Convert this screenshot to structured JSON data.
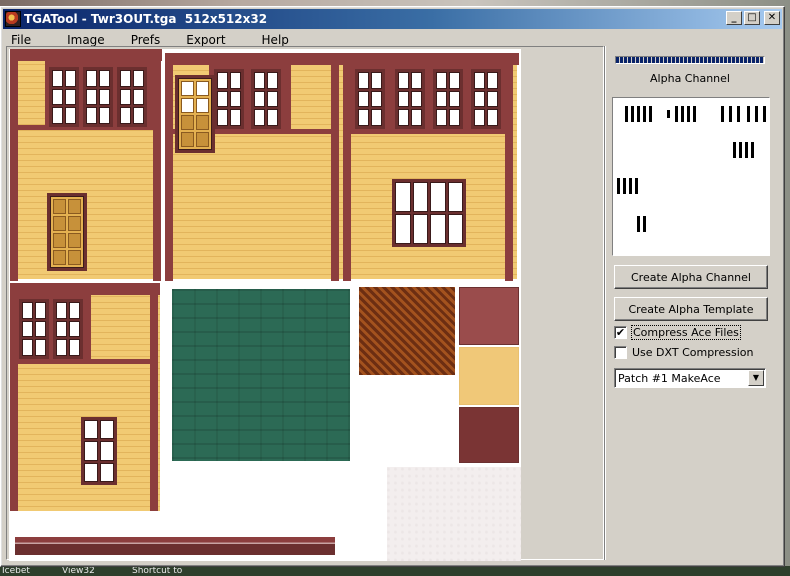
{
  "window": {
    "title": "TGATool - Twr3OUT.tga  512x512x32",
    "minimize": "_",
    "maximize": "□",
    "close": "✕"
  },
  "menu": {
    "items": [
      "File",
      "Image",
      "Prefs",
      "Export",
      "Help"
    ]
  },
  "side": {
    "alpha_label": "Alpha Channel",
    "create_alpha_channel": "Create Alpha Channel",
    "create_alpha_template": "Create Alpha Template",
    "compress_ace": {
      "label": "Compress Ace Files",
      "checked": true
    },
    "use_dxt": {
      "label": "Use DXT Compression",
      "checked": false
    },
    "dropdown": {
      "value": "Patch #1 MakeAce"
    }
  },
  "desktop": {
    "labels": [
      "Icebet",
      "View32",
      "Shortcut to"
    ]
  },
  "colors": {
    "titlebar": "#0a246a",
    "wall": "#f1ca73",
    "trim": "#8c3e3e",
    "roof": "#2c6a55"
  }
}
